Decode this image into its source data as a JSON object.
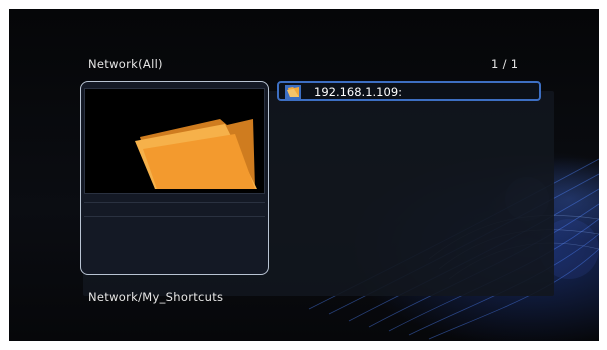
{
  "header": {
    "title": "Network(All)",
    "page": "1 / 1"
  },
  "preview": {
    "icon": "folder-icon"
  },
  "list": {
    "items": [
      {
        "label": "192.168.1.109:",
        "icon": "network-folder-icon",
        "selected": true
      }
    ]
  },
  "footer": {
    "path": "Network/My_Shortcuts"
  },
  "colors": {
    "selection_border": "#3d6fc3",
    "folder": "#f3a83a",
    "background": "#000000"
  }
}
